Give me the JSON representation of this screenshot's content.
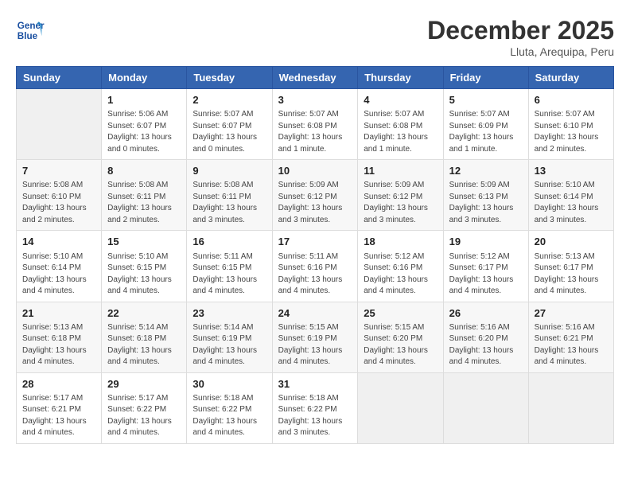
{
  "header": {
    "logo_line1": "General",
    "logo_line2": "Blue",
    "month": "December 2025",
    "location": "Lluta, Arequipa, Peru"
  },
  "weekdays": [
    "Sunday",
    "Monday",
    "Tuesday",
    "Wednesday",
    "Thursday",
    "Friday",
    "Saturday"
  ],
  "weeks": [
    [
      {
        "day": "",
        "info": ""
      },
      {
        "day": "1",
        "info": "Sunrise: 5:06 AM\nSunset: 6:07 PM\nDaylight: 13 hours\nand 0 minutes."
      },
      {
        "day": "2",
        "info": "Sunrise: 5:07 AM\nSunset: 6:07 PM\nDaylight: 13 hours\nand 0 minutes."
      },
      {
        "day": "3",
        "info": "Sunrise: 5:07 AM\nSunset: 6:08 PM\nDaylight: 13 hours\nand 1 minute."
      },
      {
        "day": "4",
        "info": "Sunrise: 5:07 AM\nSunset: 6:08 PM\nDaylight: 13 hours\nand 1 minute."
      },
      {
        "day": "5",
        "info": "Sunrise: 5:07 AM\nSunset: 6:09 PM\nDaylight: 13 hours\nand 1 minute."
      },
      {
        "day": "6",
        "info": "Sunrise: 5:07 AM\nSunset: 6:10 PM\nDaylight: 13 hours\nand 2 minutes."
      }
    ],
    [
      {
        "day": "7",
        "info": "Sunrise: 5:08 AM\nSunset: 6:10 PM\nDaylight: 13 hours\nand 2 minutes."
      },
      {
        "day": "8",
        "info": "Sunrise: 5:08 AM\nSunset: 6:11 PM\nDaylight: 13 hours\nand 2 minutes."
      },
      {
        "day": "9",
        "info": "Sunrise: 5:08 AM\nSunset: 6:11 PM\nDaylight: 13 hours\nand 3 minutes."
      },
      {
        "day": "10",
        "info": "Sunrise: 5:09 AM\nSunset: 6:12 PM\nDaylight: 13 hours\nand 3 minutes."
      },
      {
        "day": "11",
        "info": "Sunrise: 5:09 AM\nSunset: 6:12 PM\nDaylight: 13 hours\nand 3 minutes."
      },
      {
        "day": "12",
        "info": "Sunrise: 5:09 AM\nSunset: 6:13 PM\nDaylight: 13 hours\nand 3 minutes."
      },
      {
        "day": "13",
        "info": "Sunrise: 5:10 AM\nSunset: 6:14 PM\nDaylight: 13 hours\nand 3 minutes."
      }
    ],
    [
      {
        "day": "14",
        "info": "Sunrise: 5:10 AM\nSunset: 6:14 PM\nDaylight: 13 hours\nand 4 minutes."
      },
      {
        "day": "15",
        "info": "Sunrise: 5:10 AM\nSunset: 6:15 PM\nDaylight: 13 hours\nand 4 minutes."
      },
      {
        "day": "16",
        "info": "Sunrise: 5:11 AM\nSunset: 6:15 PM\nDaylight: 13 hours\nand 4 minutes."
      },
      {
        "day": "17",
        "info": "Sunrise: 5:11 AM\nSunset: 6:16 PM\nDaylight: 13 hours\nand 4 minutes."
      },
      {
        "day": "18",
        "info": "Sunrise: 5:12 AM\nSunset: 6:16 PM\nDaylight: 13 hours\nand 4 minutes."
      },
      {
        "day": "19",
        "info": "Sunrise: 5:12 AM\nSunset: 6:17 PM\nDaylight: 13 hours\nand 4 minutes."
      },
      {
        "day": "20",
        "info": "Sunrise: 5:13 AM\nSunset: 6:17 PM\nDaylight: 13 hours\nand 4 minutes."
      }
    ],
    [
      {
        "day": "21",
        "info": "Sunrise: 5:13 AM\nSunset: 6:18 PM\nDaylight: 13 hours\nand 4 minutes."
      },
      {
        "day": "22",
        "info": "Sunrise: 5:14 AM\nSunset: 6:18 PM\nDaylight: 13 hours\nand 4 minutes."
      },
      {
        "day": "23",
        "info": "Sunrise: 5:14 AM\nSunset: 6:19 PM\nDaylight: 13 hours\nand 4 minutes."
      },
      {
        "day": "24",
        "info": "Sunrise: 5:15 AM\nSunset: 6:19 PM\nDaylight: 13 hours\nand 4 minutes."
      },
      {
        "day": "25",
        "info": "Sunrise: 5:15 AM\nSunset: 6:20 PM\nDaylight: 13 hours\nand 4 minutes."
      },
      {
        "day": "26",
        "info": "Sunrise: 5:16 AM\nSunset: 6:20 PM\nDaylight: 13 hours\nand 4 minutes."
      },
      {
        "day": "27",
        "info": "Sunrise: 5:16 AM\nSunset: 6:21 PM\nDaylight: 13 hours\nand 4 minutes."
      }
    ],
    [
      {
        "day": "28",
        "info": "Sunrise: 5:17 AM\nSunset: 6:21 PM\nDaylight: 13 hours\nand 4 minutes."
      },
      {
        "day": "29",
        "info": "Sunrise: 5:17 AM\nSunset: 6:22 PM\nDaylight: 13 hours\nand 4 minutes."
      },
      {
        "day": "30",
        "info": "Sunrise: 5:18 AM\nSunset: 6:22 PM\nDaylight: 13 hours\nand 4 minutes."
      },
      {
        "day": "31",
        "info": "Sunrise: 5:18 AM\nSunset: 6:22 PM\nDaylight: 13 hours\nand 3 minutes."
      },
      {
        "day": "",
        "info": ""
      },
      {
        "day": "",
        "info": ""
      },
      {
        "day": "",
        "info": ""
      }
    ]
  ]
}
